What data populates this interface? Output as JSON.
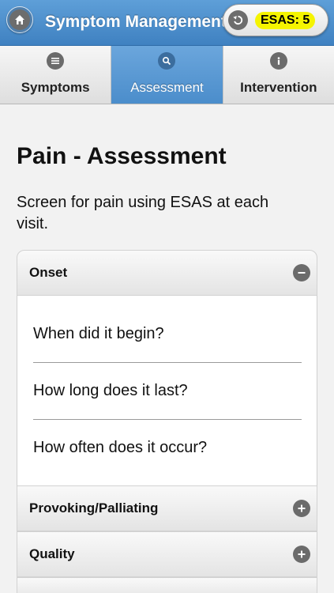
{
  "header": {
    "title": "Symptom Management",
    "esas_label": "ESAS: 5",
    "home_icon": "home-icon",
    "undo_icon": "undo-icon"
  },
  "tabs": [
    {
      "label": "Symptoms",
      "icon": "list-icon",
      "active": false
    },
    {
      "label": "Assessment",
      "icon": "search-icon",
      "active": true
    },
    {
      "label": "Intervention",
      "icon": "info-icon",
      "active": false
    }
  ],
  "content": {
    "title": "Pain - Assessment",
    "intro": "Screen for pain using ESAS at each visit.",
    "sections": [
      {
        "label": "Onset",
        "expanded": true,
        "questions": [
          "When did it begin?",
          "How long does it last?",
          "How often does it occur?"
        ]
      },
      {
        "label": "Provoking/Palliating",
        "expanded": false
      },
      {
        "label": "Quality",
        "expanded": false
      }
    ]
  },
  "colors": {
    "header_blue": "#4a8bca",
    "esas_badge": "#f5f400",
    "icon_gray": "#6b6b6b"
  }
}
